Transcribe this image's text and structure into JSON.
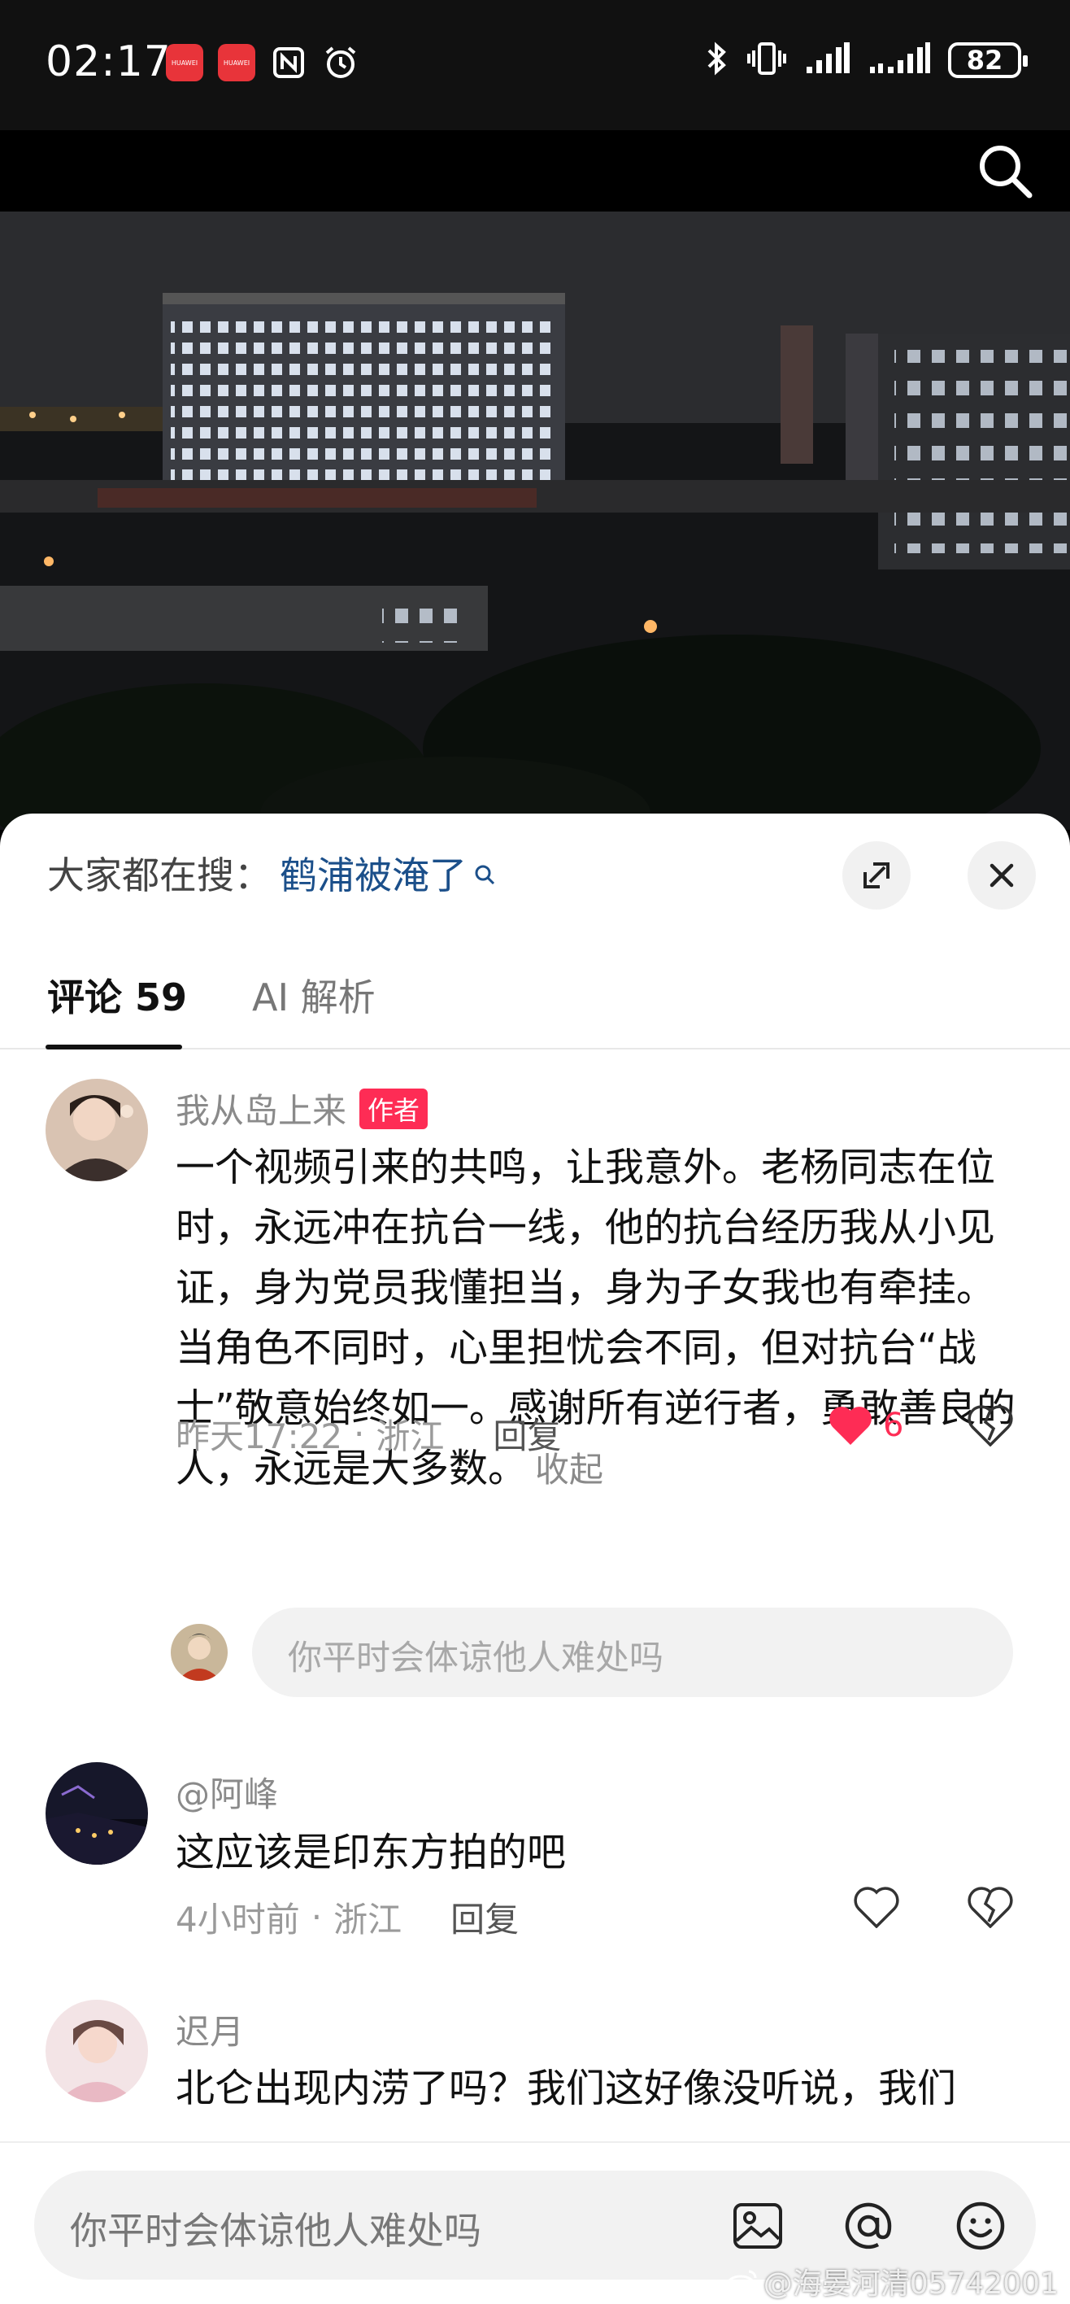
{
  "status_bar": {
    "time": "02:17",
    "battery": "82",
    "app_icons": [
      "huawei-app-icon",
      "huawei-app-icon",
      "nfc-icon",
      "alarm-icon"
    ],
    "right_icons": [
      "bluetooth-icon",
      "vibrate-icon",
      "signal-icon",
      "signal-icon"
    ]
  },
  "panel": {
    "trending_label": "大家都在搜：",
    "trending_query": "鹤浦被淹了",
    "tabs": [
      {
        "label": "评论 59"
      },
      {
        "label": "AI 解析"
      }
    ]
  },
  "comments": [
    {
      "name": "我从岛上来",
      "author_tag": "作者",
      "text": "一个视频引来的共鸣，让我意外。老杨同志在位时，永远冲在抗台一线，他的抗台经历我从小见证，身为党员我懂担当，身为子女我也有牵挂。当角色不同时，心里担忧会不同，但对抗台“战士”敬意始终如一。感谢所有逆行者，勇敢善良的人，永远是大多数。",
      "fold": "收起",
      "time": "昨天17:22",
      "location": "浙江",
      "reply": "回复",
      "likes": "6",
      "liked": true
    },
    {
      "name": "@阿峰",
      "text": "这应该是印东方拍的吧",
      "time": "4小时前",
      "location": "浙江",
      "reply": "回复"
    },
    {
      "name": "迟月",
      "text": "北仑出现内涝了吗？我们这好像没听说，我们"
    }
  ],
  "reply_placeholder": "你平时会体谅他人难处吗",
  "bottom_input": {
    "placeholder": "你平时会体谅他人难处吗"
  },
  "watermark": "@海晏河清05742001",
  "separator": "·",
  "colors": {
    "accent": "#fe2c55",
    "link": "#1b4f8a"
  }
}
